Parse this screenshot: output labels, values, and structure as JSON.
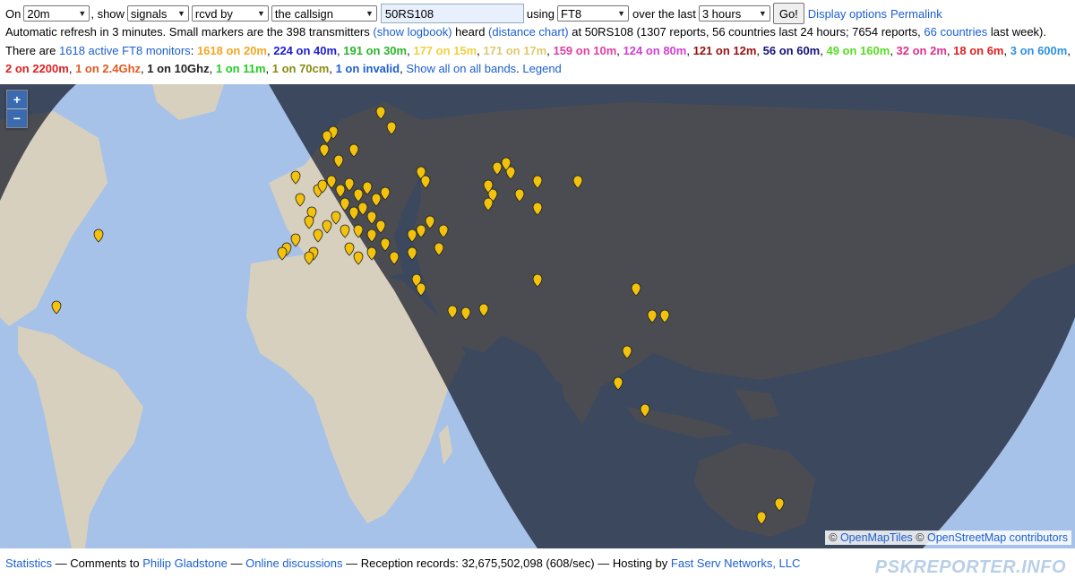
{
  "controls": {
    "on_label": "On",
    "band": "20m",
    "show_label": ", show",
    "what": "signals",
    "direction": "rcvd by",
    "target": "the callsign",
    "callsign": "50RS108",
    "using_label": "using",
    "mode": "FT8",
    "over_label": "over the last",
    "period": "3 hours",
    "go": "Go!",
    "display_options": "Display options",
    "permalink": "Permalink"
  },
  "status": {
    "prefix": "Automatic refresh in 3 minutes. Small markers are the 398 transmitters",
    "show_logbook": "(show logbook)",
    "heard": "heard",
    "distance_chart": "(distance chart)",
    "at_text": "at 50RS108 (1307 reports, 56 countries last 24 hours; 7654 reports,",
    "countries_link": "66 countries",
    "suffix": "last week)."
  },
  "monitors": {
    "prefix": "There are",
    "active_link": "1618 active FT8 monitors",
    "colon": ":",
    "bands": [
      {
        "text": "1618 on 20m",
        "color": "#f5a623"
      },
      {
        "text": "224 on 40m",
        "color": "#1d1dd1"
      },
      {
        "text": "191 on 30m",
        "color": "#2bb52b"
      },
      {
        "text": "177 on 15m",
        "color": "#f0d040"
      },
      {
        "text": "171 on 17m",
        "color": "#e0c870"
      },
      {
        "text": "159 on 10m",
        "color": "#e040a0"
      },
      {
        "text": "124 on 80m",
        "color": "#d040d0"
      },
      {
        "text": "121 on 12m",
        "color": "#9a1010"
      },
      {
        "text": "56 on 60m",
        "color": "#14147a"
      },
      {
        "text": "49 on 160m",
        "color": "#55dd22"
      },
      {
        "text": "32 on 2m",
        "color": "#e0308a"
      },
      {
        "text": "18 on 6m",
        "color": "#e02020"
      },
      {
        "text": "3 on 600m",
        "color": "#3090e0"
      },
      {
        "text": "2 on 2200m",
        "color": "#e02020"
      },
      {
        "text": "1 on 2.4Ghz",
        "color": "#e05a20"
      },
      {
        "text": "1 on 10Ghz",
        "color": "#222222"
      },
      {
        "text": "1 on 11m",
        "color": "#22cc22"
      },
      {
        "text": "1 on 70cm",
        "color": "#8a8a10"
      },
      {
        "text": "1 on invalid",
        "color": "#1d5fd1"
      }
    ],
    "show_all": "Show all on all bands",
    "legend": "Legend"
  },
  "map": {
    "zoom_in": "+",
    "zoom_out": "−",
    "attribution_prefix": "©",
    "openmaptiles": "OpenMapTiles",
    "osm": "OpenStreetMap contributors",
    "marker_color": "#f2c20c"
  },
  "footer": {
    "statistics": "Statistics",
    "comments": "— Comments to",
    "author": "Philip Gladstone",
    "dash": "—",
    "discussions": "Online discussions",
    "records": "— Reception records: 32,675,502,098 (608/sec) — Hosting by",
    "hosting": "Fast Serv Networks, LLC",
    "brand": "PSKREPORTER.INFO"
  }
}
